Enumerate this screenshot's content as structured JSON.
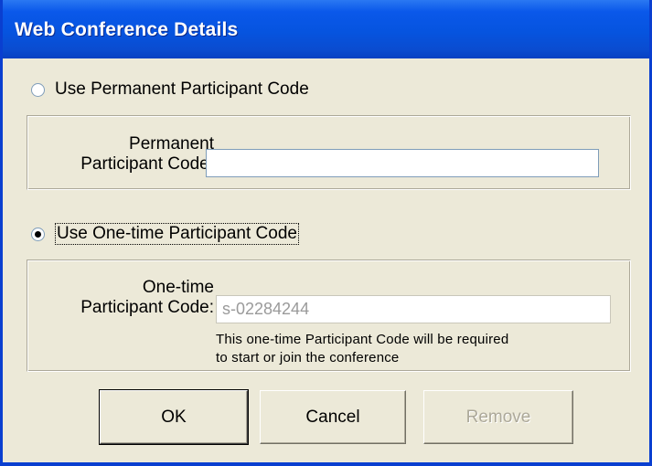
{
  "window": {
    "title": "Web Conference Details"
  },
  "permanent": {
    "radio_label": "Use Permanent Participant Code",
    "field_label_line1": "Permanent",
    "field_label_line2": "Participant Code:",
    "value": ""
  },
  "onetime": {
    "radio_label": "Use One-time Participant Code",
    "field_label_line1": "One-time",
    "field_label_line2": "Participant Code:",
    "value": "s-02284244",
    "note_line1": "This one-time Participant Code will be required",
    "note_line2": "to start or join the conference"
  },
  "buttons": {
    "ok": "OK",
    "cancel": "Cancel",
    "remove": "Remove"
  },
  "colors": {
    "titlebar": "#0a58ea",
    "dialog_bg": "#ece9d8",
    "radio_selected": "#000000"
  }
}
